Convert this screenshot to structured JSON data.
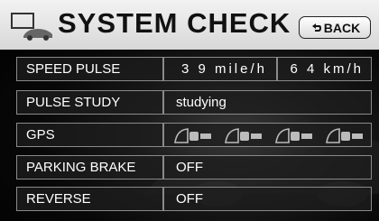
{
  "header": {
    "title": "SYSTEM CHECK",
    "back_label": "BACK"
  },
  "rows": [
    {
      "label": "SPEED PULSE",
      "value_a": "3 9 mile/h",
      "value_b": "6 4 km/h"
    },
    {
      "label": "PULSE STUDY",
      "value": "studying"
    },
    {
      "label": "GPS",
      "icons": [
        "gps-satellite-icon",
        "gps-satellite-icon",
        "gps-satellite-icon",
        "gps-satellite-icon"
      ]
    },
    {
      "label": "PARKING BRAKE",
      "value": "OFF"
    },
    {
      "label": "REVERSE",
      "value": "OFF"
    }
  ],
  "colors": {
    "text": "#ffffff",
    "header_bg": "#e6e6e6",
    "border": "#8a8a8a"
  }
}
